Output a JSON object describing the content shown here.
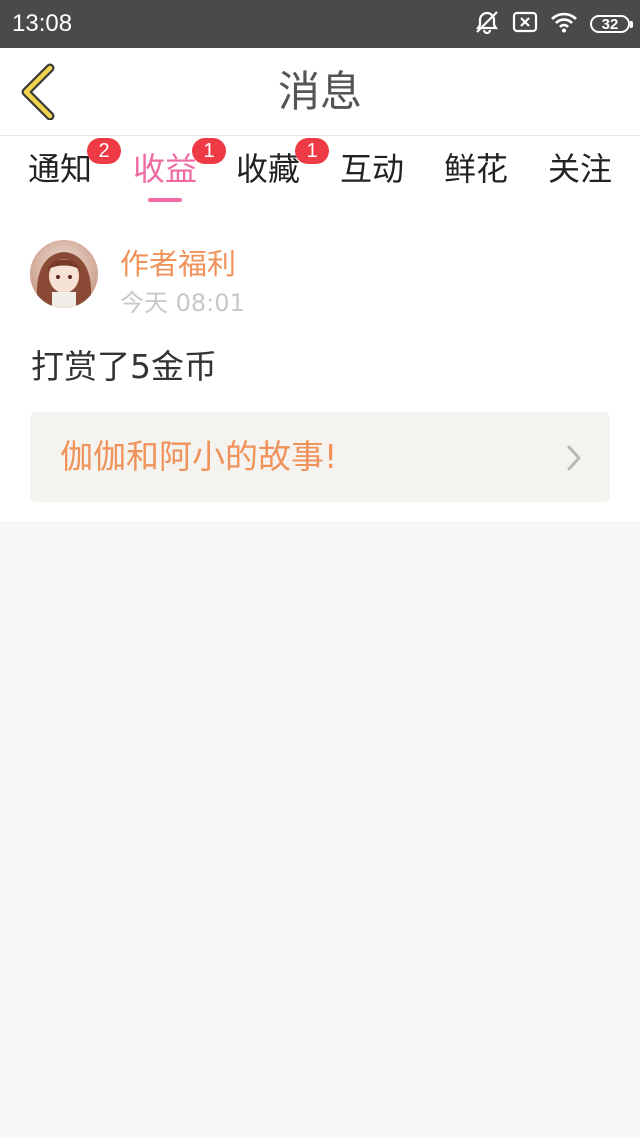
{
  "status_bar": {
    "time": "13:08",
    "battery_level": "32",
    "icons": [
      "alarm-off-icon",
      "sim-error-icon",
      "wifi-icon",
      "battery-icon"
    ]
  },
  "header": {
    "title": "消息",
    "back_icon": "chevron-left-icon"
  },
  "tabs": [
    {
      "label": "通知",
      "badge": "2"
    },
    {
      "label": "收益",
      "badge": "1",
      "active": true
    },
    {
      "label": "收藏",
      "badge": "1"
    },
    {
      "label": "互动"
    },
    {
      "label": "鲜花"
    },
    {
      "label": "关注"
    }
  ],
  "message": {
    "sender": "作者福利",
    "time": "今天 08:01",
    "text": "打赏了5金币",
    "book_title": "伽伽和阿小的故事!"
  },
  "colors": {
    "accent": "#ef6aa2",
    "name_orange": "#f0935a",
    "badge_red": "#ee3a44",
    "back_arrow_yellow": "#f2d54e",
    "status_bar": "#4a4a4a",
    "page_bg": "#f8f6f6"
  }
}
